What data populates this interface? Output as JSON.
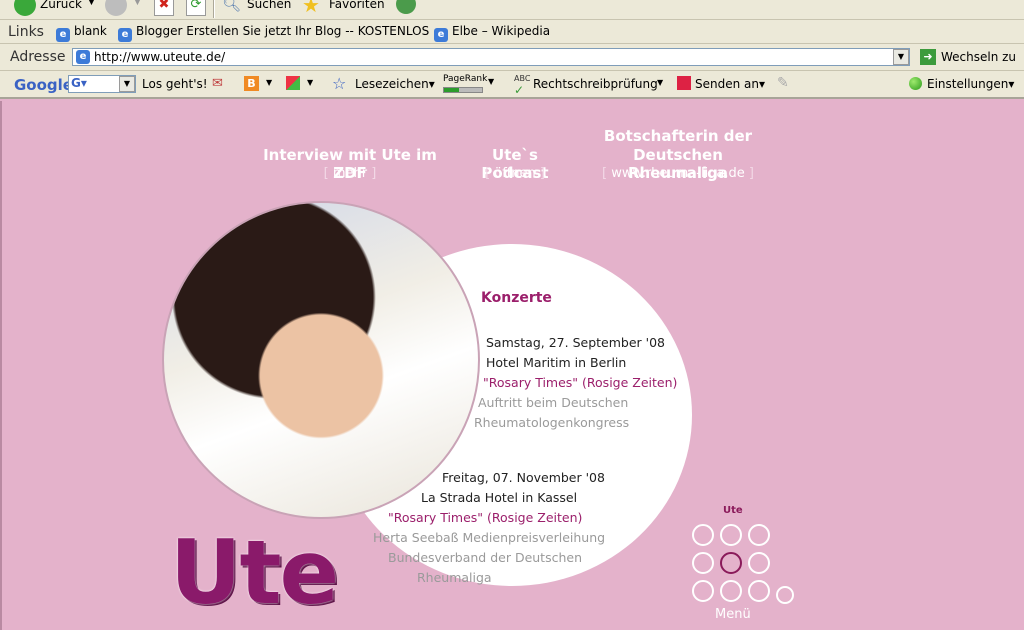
{
  "browser": {
    "toolbar": {
      "back_label": "Zurück",
      "search_label": "Suchen",
      "favorites_label": "Favoriten"
    },
    "links_bar": {
      "label": "Links",
      "items": [
        "blank",
        "Blogger Erstellen Sie jetzt Ihr Blog -- KOSTENLOS",
        "Elbe – Wikipedia"
      ]
    },
    "address_bar": {
      "label": "Adresse",
      "url": "http://www.uteute.de/",
      "go_label": "Wechseln zu"
    },
    "google_bar": {
      "logo": "Google",
      "go_label": "Los geht's!",
      "bookmarks_label": "Lesezeichen",
      "pagerank_label": "PageRank",
      "spellcheck_label": "Rechtschreibprüfung",
      "send_label": "Senden an",
      "settings_label": "Einstellungen"
    }
  },
  "page": {
    "nav": [
      {
        "title": "Interview mit Ute im ZDF",
        "link": "mehr"
      },
      {
        "title": "Ute`s Podcast",
        "link": "öffnen"
      },
      {
        "title_line1": "Botschafterin der",
        "title_line2": "Deutschen Rheumaliga",
        "link": "www.rheuma-liga.de"
      }
    ],
    "concerts": {
      "heading": "Konzerte",
      "events": [
        {
          "date": "Samstag, 27. September '08",
          "venue": "Hotel Maritim in Berlin",
          "program": "\"Rosary Times\" (Rosige Zeiten)",
          "note_line1": "Auftritt beim Deutschen",
          "note_line2": "Rheumatologenkongress"
        },
        {
          "date": "Freitag, 07. November '08",
          "venue": "La Strada Hotel in Kassel",
          "program": "\"Rosary Times\" (Rosige Zeiten)",
          "note_line1": "Herta Seebaß Medienpreisverleihung",
          "note_line2": "Bundesverband der Deutschen",
          "note_line3": "Rheumaliga"
        }
      ]
    },
    "logo_text": "Ute",
    "menu": {
      "top_label": "Ute",
      "bottom_label": "Menü"
    }
  },
  "colors": {
    "background": "#e4b2cb",
    "accent": "#9b1f6b",
    "chrome": "#ece9d8"
  }
}
